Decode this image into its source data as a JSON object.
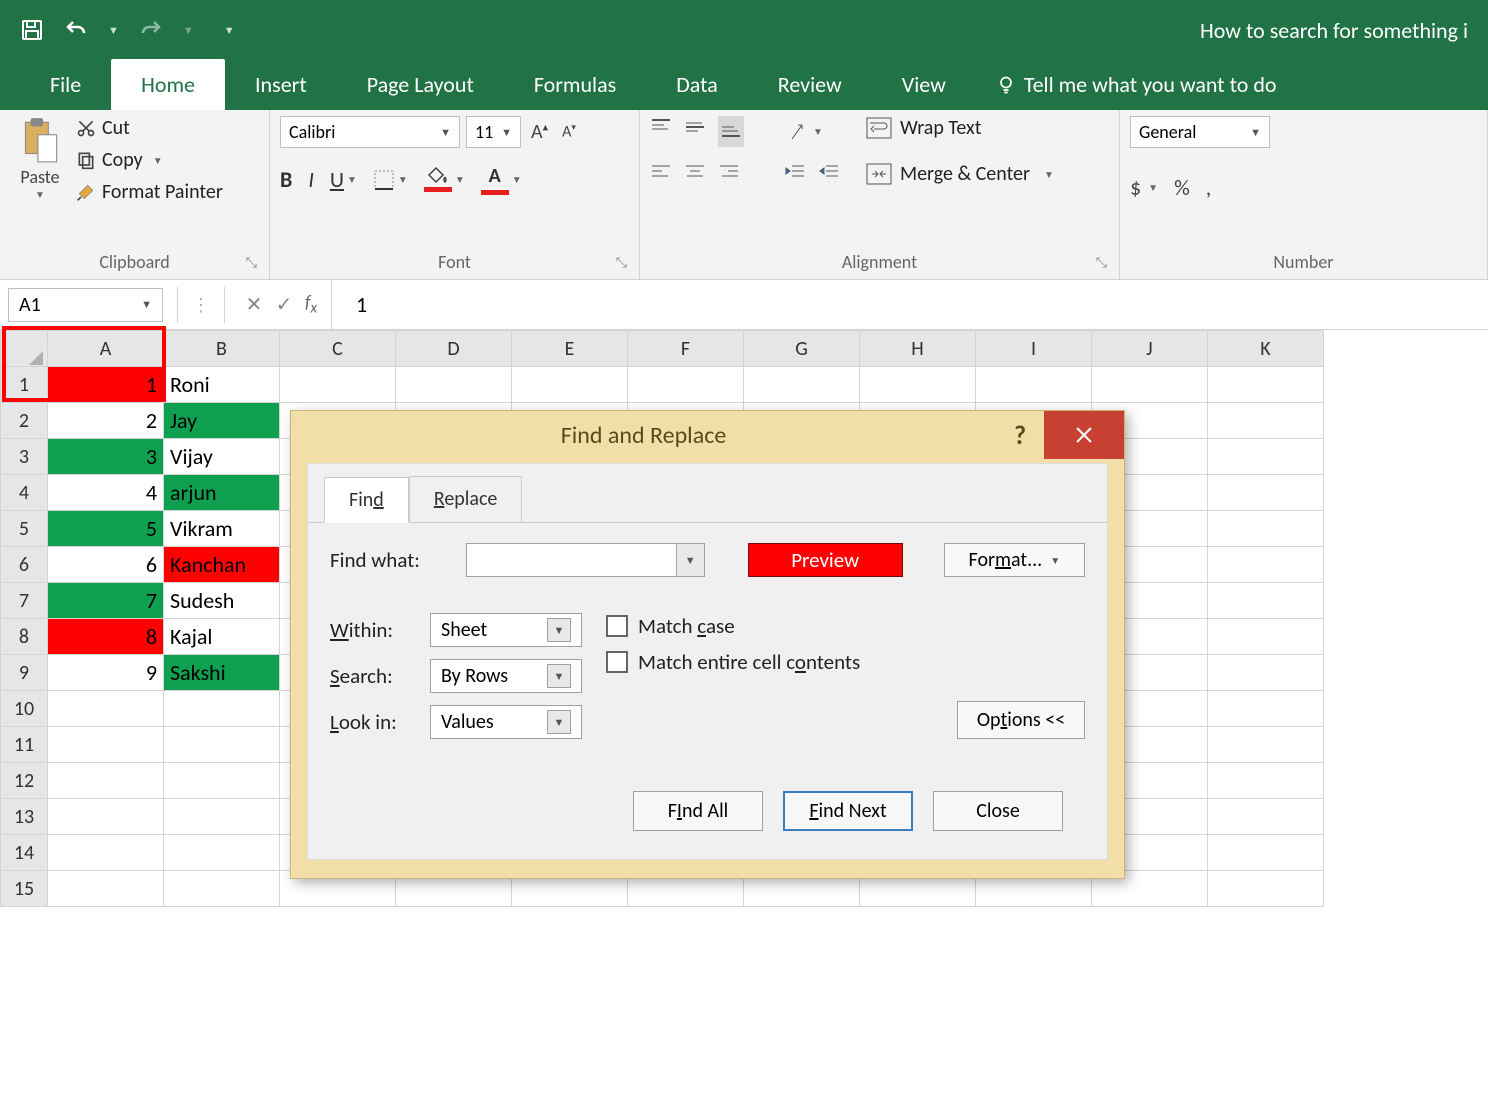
{
  "title_right": "How to search for something i",
  "tabs": {
    "file": "File",
    "home": "Home",
    "insert": "Insert",
    "page_layout": "Page Layout",
    "formulas": "Formulas",
    "data": "Data",
    "review": "Review",
    "view": "View",
    "tell_me": "Tell me what you want to do"
  },
  "ribbon": {
    "clipboard": {
      "paste": "Paste",
      "cut": "Cut",
      "copy": "Copy",
      "format_painter": "Format Painter",
      "label": "Clipboard"
    },
    "font": {
      "name": "Calibri",
      "size": "11",
      "label": "Font"
    },
    "alignment": {
      "wrap": "Wrap Text",
      "merge": "Merge & Center",
      "label": "Alignment"
    },
    "number": {
      "format": "General",
      "label": "Number"
    }
  },
  "formula_bar": {
    "name_box": "A1",
    "value": "1"
  },
  "columns": [
    "A",
    "B",
    "C",
    "D",
    "E",
    "F",
    "G",
    "H",
    "I",
    "J",
    "K"
  ],
  "rows": [
    {
      "n": "1",
      "a": "1",
      "b": "Roni",
      "a_cls": "g-red",
      "b_cls": ""
    },
    {
      "n": "2",
      "a": "2",
      "b": "Jay",
      "a_cls": "",
      "b_cls": "g-green"
    },
    {
      "n": "3",
      "a": "3",
      "b": "Vijay",
      "a_cls": "g-green",
      "b_cls": ""
    },
    {
      "n": "4",
      "a": "4",
      "b": "arjun",
      "a_cls": "",
      "b_cls": "g-green"
    },
    {
      "n": "5",
      "a": "5",
      "b": "Vikram",
      "a_cls": "g-green",
      "b_cls": ""
    },
    {
      "n": "6",
      "a": "6",
      "b": "Kanchan",
      "a_cls": "",
      "b_cls": "g-red"
    },
    {
      "n": "7",
      "a": "7",
      "b": "Sudesh",
      "a_cls": "g-green",
      "b_cls": ""
    },
    {
      "n": "8",
      "a": "8",
      "b": "Kajal",
      "a_cls": "g-red",
      "b_cls": ""
    },
    {
      "n": "9",
      "a": "9",
      "b": "Sakshi",
      "a_cls": "",
      "b_cls": "g-green"
    },
    {
      "n": "10",
      "a": "",
      "b": "",
      "a_cls": "",
      "b_cls": ""
    },
    {
      "n": "11",
      "a": "",
      "b": "",
      "a_cls": "",
      "b_cls": ""
    },
    {
      "n": "12",
      "a": "",
      "b": "",
      "a_cls": "",
      "b_cls": ""
    },
    {
      "n": "13",
      "a": "",
      "b": "",
      "a_cls": "",
      "b_cls": ""
    },
    {
      "n": "14",
      "a": "",
      "b": "",
      "a_cls": "",
      "b_cls": ""
    },
    {
      "n": "15",
      "a": "",
      "b": "",
      "a_cls": "",
      "b_cls": ""
    }
  ],
  "dialog": {
    "title": "Find and Replace",
    "tab_find": "d",
    "tab_find_pre": "Fin",
    "tab_replace": "R",
    "tab_replace_post": "eplace",
    "find_what_label": "Find what:",
    "find_value": "",
    "preview_btn": "Preview",
    "format_btn_pre": "For",
    "format_btn_u": "m",
    "format_btn_post": "at...",
    "within_label": "Within:",
    "within_value": "Sheet",
    "search_label": "Search:",
    "search_value": "By Rows",
    "lookin_label": "Look in:",
    "lookin_value": "Values",
    "match_case_pre": "Match ",
    "match_case_u": "c",
    "match_case_post": "ase",
    "match_entire_pre": "Match entire cell c",
    "match_entire_u": "o",
    "match_entire_post": "ntents",
    "options_btn_pre": "Op",
    "options_btn_u": "t",
    "options_btn_post": "ions <<",
    "find_all_pre": "Find All",
    "find_all_u": "I",
    "find_next_pre": "",
    "find_next_u": "F",
    "find_next_post": "ind Next",
    "close_btn": "Close"
  }
}
